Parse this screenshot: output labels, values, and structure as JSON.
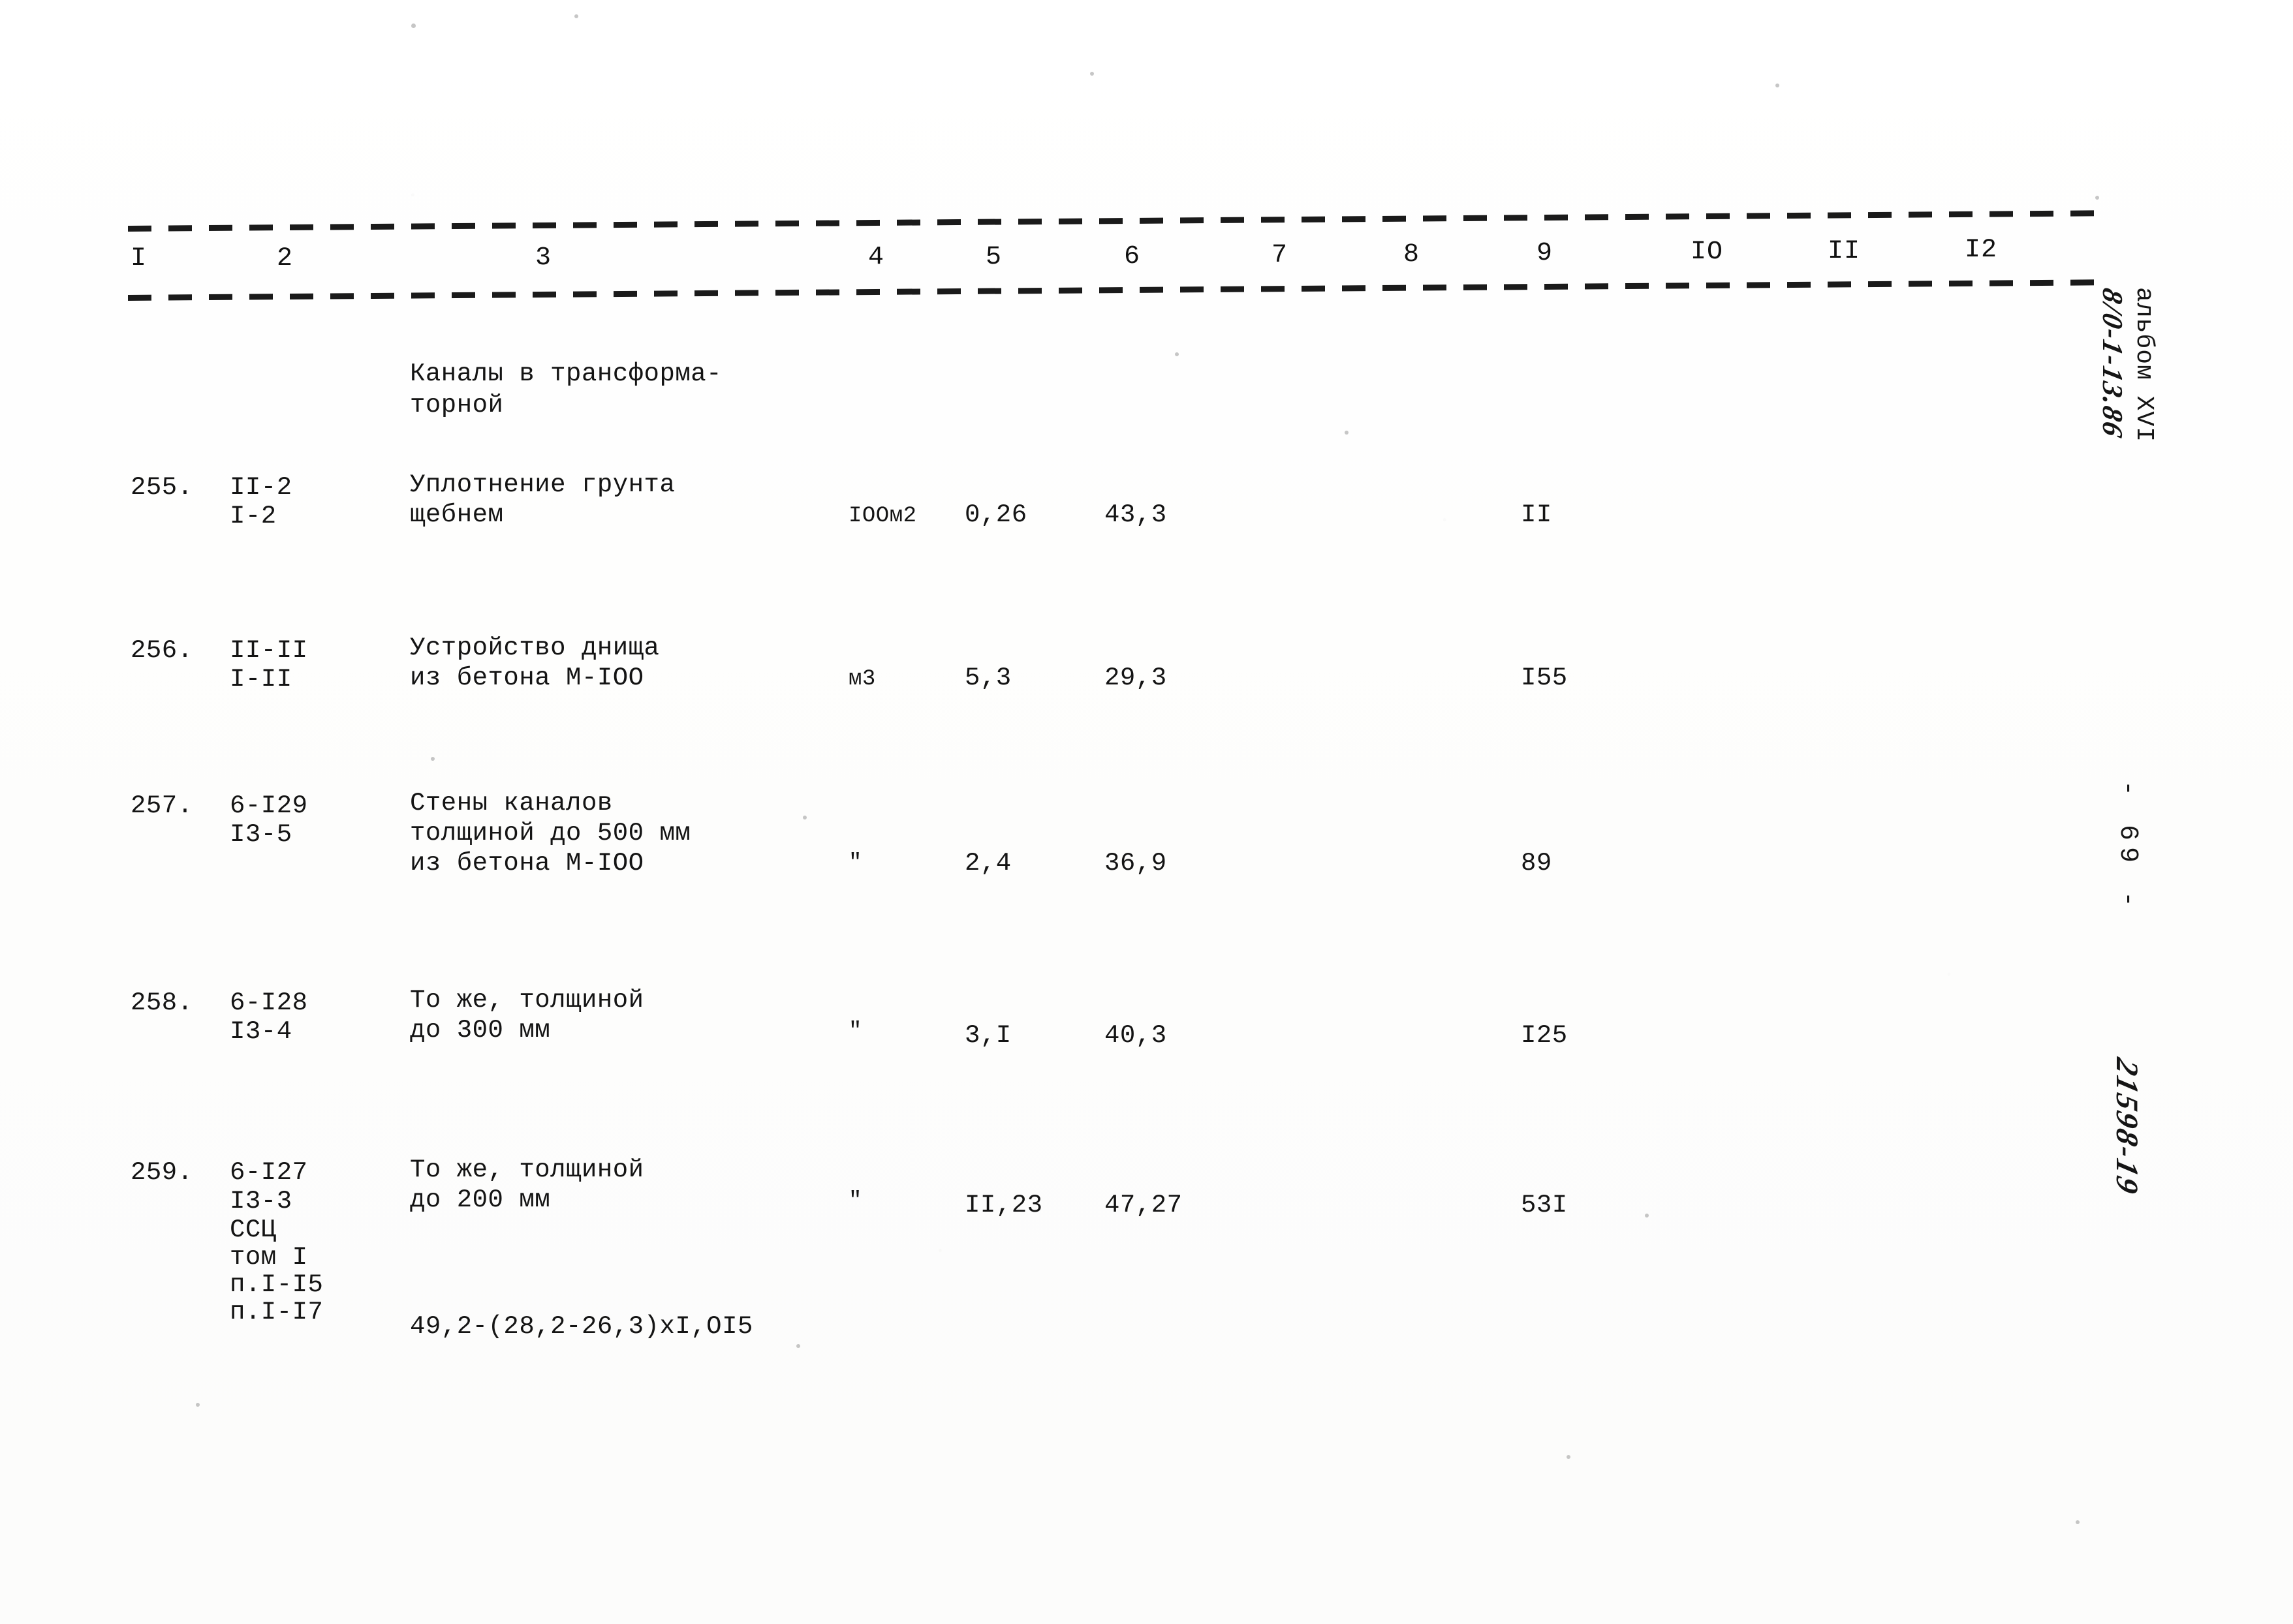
{
  "document": {
    "type": "scanned-estimate-table",
    "column_headers": [
      "I",
      "2",
      "3",
      "4",
      "5",
      "6",
      "7",
      "8",
      "9",
      "IO",
      "II",
      "I2"
    ],
    "section_title_line1": "Каналы в трансформа-",
    "section_title_line2": "торной"
  },
  "margin": {
    "album_label": "альбом ХVI",
    "album_handwritten": "8/0-1-13.86",
    "page_number": "- 69 -",
    "doc_code_handwritten": "21598-19"
  },
  "rows": [
    {
      "num": "255.",
      "code_line1": "II-2",
      "code_line2": "I-2",
      "desc_line1": "Уплотнение грунта",
      "desc_line2": "щебнем",
      "desc_line3": "",
      "unit": "IOOм2",
      "col5": "0,26",
      "col6": "43,3",
      "col7": "",
      "col8": "",
      "col9": "II",
      "col10": "",
      "col11": "",
      "col12": ""
    },
    {
      "num": "256.",
      "code_line1": "II-II",
      "code_line2": "I-II",
      "desc_line1": "Устройство днища",
      "desc_line2": "из бетона М-IOO",
      "desc_line3": "",
      "unit": "м3",
      "col5": "5,3",
      "col6": "29,3",
      "col7": "",
      "col8": "",
      "col9": "I55",
      "col10": "",
      "col11": "",
      "col12": ""
    },
    {
      "num": "257.",
      "code_line1": "6-I29",
      "code_line2": "I3-5",
      "desc_line1": "Стены каналов",
      "desc_line2": "толщиной до 500 мм",
      "desc_line3": "из бетона М-IOO",
      "unit": "\"",
      "col5": "2,4",
      "col6": "36,9",
      "col7": "",
      "col8": "",
      "col9": "89",
      "col10": "",
      "col11": "",
      "col12": ""
    },
    {
      "num": "258.",
      "code_line1": "6-I28",
      "code_line2": "I3-4",
      "desc_line1": "То же, толщиной",
      "desc_line2": "до 300 мм",
      "desc_line3": "",
      "unit": "\"",
      "col5": "3,I",
      "col6": "40,3",
      "col7": "",
      "col8": "",
      "col9": "I25",
      "col10": "",
      "col11": "",
      "col12": ""
    },
    {
      "num": "259.",
      "code_line1": "6-I27",
      "code_line2": "I3-3",
      "code_line3": "ССЦ",
      "code_line4": "том I",
      "code_line5": "п.I-I5",
      "code_line6": "п.I-I7",
      "desc_line1": "То же, толщиной",
      "desc_line2": "до 200 мм",
      "desc_line3": "",
      "unit": "\"",
      "col5": "II,23",
      "col6": "47,27",
      "col7": "",
      "col8": "",
      "col9": "53I",
      "col10": "",
      "col11": "",
      "col12": "",
      "formula": "49,2-(28,2-26,3)xI,OI5"
    }
  ],
  "chart_data": {
    "type": "table",
    "title": "Каналы в трансформаторной",
    "columns": [
      "I",
      "2",
      "3",
      "4",
      "5",
      "6",
      "7",
      "8",
      "9",
      "IO",
      "II",
      "I2"
    ],
    "rows": [
      [
        "255.",
        "II-2 / I-2",
        "Уплотнение грунта щебнем",
        "IOOм2",
        "0,26",
        "43,3",
        "",
        "",
        "II",
        "",
        "",
        ""
      ],
      [
        "256.",
        "II-II / I-II",
        "Устройство днища из бетона М-IOO",
        "м3",
        "5,3",
        "29,3",
        "",
        "",
        "I55",
        "",
        "",
        ""
      ],
      [
        "257.",
        "6-I29 / I3-5",
        "Стены каналов толщиной до 500 мм из бетона М-IOO",
        "\"",
        "2,4",
        "36,9",
        "",
        "",
        "89",
        "",
        "",
        ""
      ],
      [
        "258.",
        "6-I28 / I3-4",
        "То же, толщиной до 300 мм",
        "\"",
        "3,I",
        "40,3",
        "",
        "",
        "I25",
        "",
        "",
        ""
      ],
      [
        "259.",
        "6-I27 / I3-3 / ССЦ том I п.I-I5 п.I-I7",
        "То же, толщиной до 200 мм; 49,2-(28,2-26,3)xI,OI5",
        "\"",
        "II,23",
        "47,27",
        "",
        "",
        "53I",
        "",
        "",
        ""
      ]
    ]
  }
}
